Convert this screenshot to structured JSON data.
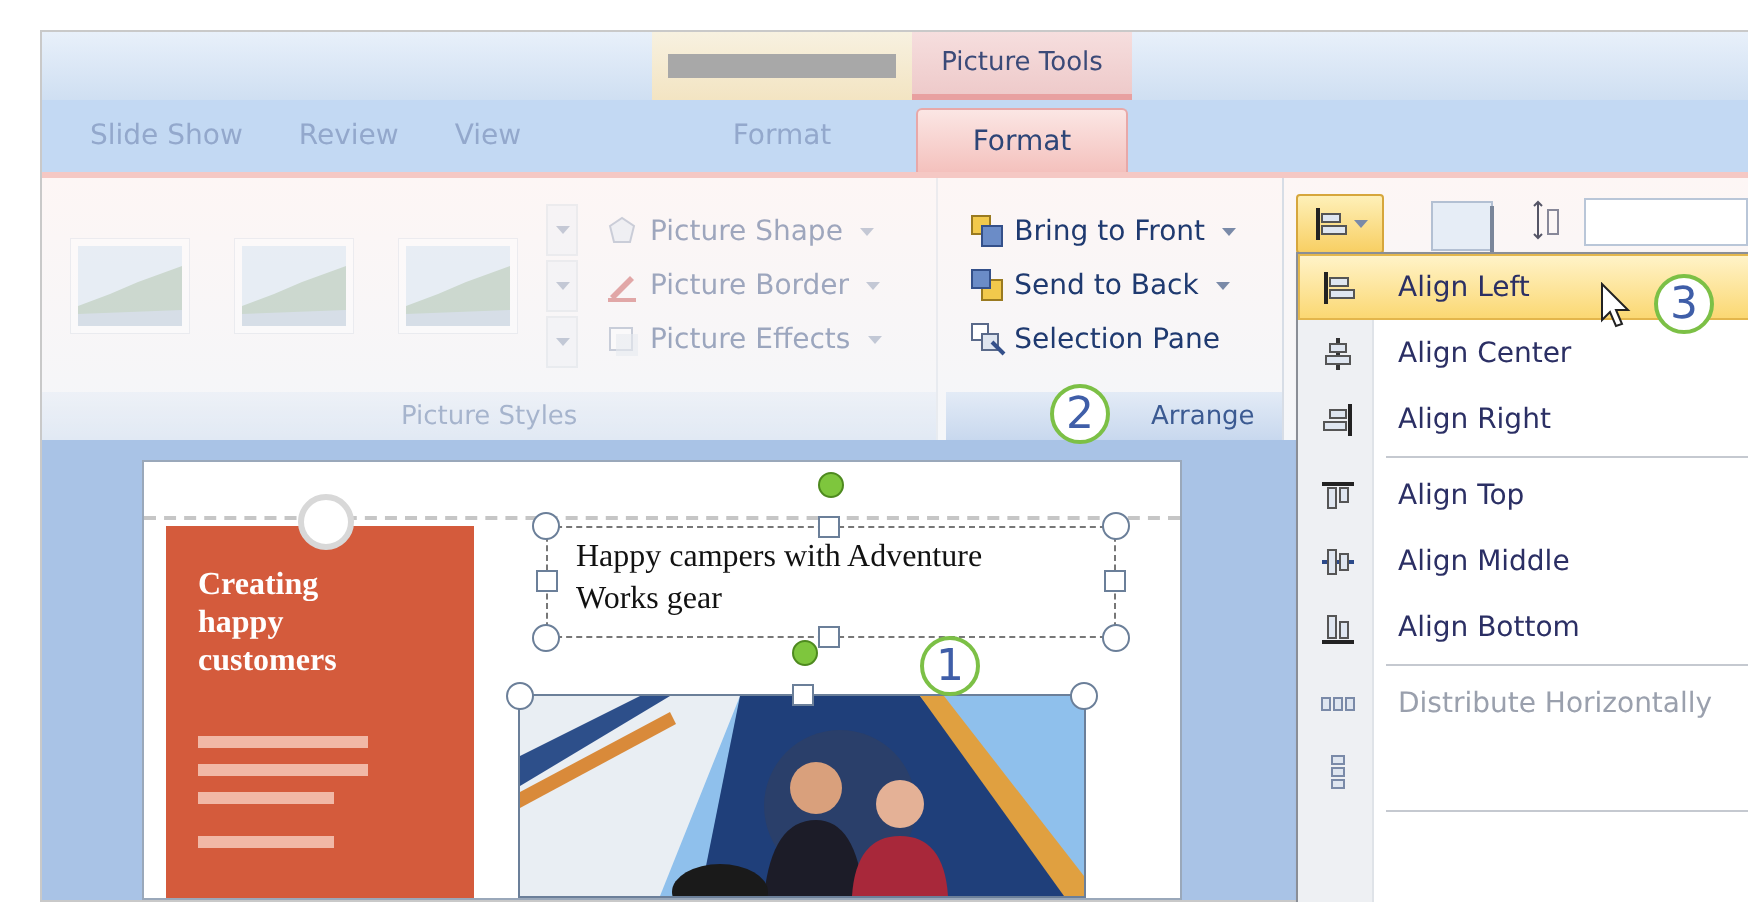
{
  "context_tabs": [
    {
      "label": "Picture Tools"
    }
  ],
  "tabs": [
    {
      "label": "Slide Show",
      "selected": false
    },
    {
      "label": "Review",
      "selected": false
    },
    {
      "label": "View",
      "selected": false
    },
    {
      "label": "Format",
      "selected": false
    },
    {
      "label": "Format",
      "selected": true
    }
  ],
  "groups": [
    {
      "label": "Picture Styles",
      "dimmed": true,
      "commands": [
        "Picture Shape",
        "Picture Border",
        "Picture Effects"
      ]
    },
    {
      "label": "Arrange",
      "dimmed": false,
      "commands": [
        "Bring to Front",
        "Send to Back",
        "Selection Pane"
      ]
    }
  ],
  "align_menu": {
    "items": [
      {
        "kind": "item",
        "label": "Align Left",
        "selected": true,
        "disabled": false
      },
      {
        "kind": "item",
        "label": "Align Center",
        "selected": false,
        "disabled": false
      },
      {
        "kind": "item",
        "label": "Align Right",
        "selected": false,
        "disabled": false
      },
      {
        "kind": "separator"
      },
      {
        "kind": "item",
        "label": "Align Top",
        "selected": false,
        "disabled": false
      },
      {
        "kind": "item",
        "label": "Align Middle",
        "selected": false,
        "disabled": false
      },
      {
        "kind": "item",
        "label": "Align Bottom",
        "selected": false,
        "disabled": false
      },
      {
        "kind": "separator"
      },
      {
        "kind": "item",
        "label": "Distribute Horizontally",
        "selected": false,
        "disabled": true
      },
      {
        "kind": "icon_only"
      },
      {
        "kind": "separator"
      }
    ]
  },
  "slide": {
    "panel_title": "Creating happy customers",
    "caption": "Happy campers with Adventure Works gear"
  },
  "callouts": [
    "1",
    "2",
    "3"
  ]
}
